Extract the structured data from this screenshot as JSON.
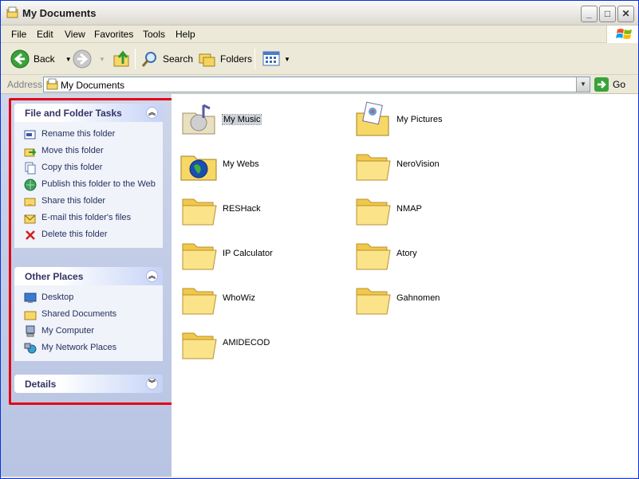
{
  "window": {
    "title": "My Documents"
  },
  "menubar": {
    "items": [
      "File",
      "Edit",
      "View",
      "Favorites",
      "Tools",
      "Help"
    ]
  },
  "toolbar": {
    "back_label": "Back",
    "search_label": "Search",
    "folders_label": "Folders"
  },
  "address": {
    "label": "Address",
    "value": "My Documents",
    "go_label": "Go"
  },
  "taskpane": {
    "file_tasks": {
      "title": "File and Folder Tasks",
      "items": [
        {
          "label": "Rename this folder",
          "icon": "rename-icon"
        },
        {
          "label": "Move this folder",
          "icon": "move-icon"
        },
        {
          "label": "Copy this folder",
          "icon": "copy-icon"
        },
        {
          "label": "Publish this folder to the Web",
          "icon": "publish-web-icon"
        },
        {
          "label": "Share this folder",
          "icon": "share-icon"
        },
        {
          "label": "E-mail this folder's files",
          "icon": "email-icon"
        },
        {
          "label": "Delete this folder",
          "icon": "delete-icon"
        }
      ]
    },
    "other_places": {
      "title": "Other Places",
      "items": [
        {
          "label": "Desktop",
          "icon": "desktop-icon"
        },
        {
          "label": "Shared Documents",
          "icon": "folder-icon"
        },
        {
          "label": "My Computer",
          "icon": "computer-icon"
        },
        {
          "label": "My Network Places",
          "icon": "network-icon"
        }
      ]
    },
    "details": {
      "title": "Details"
    }
  },
  "folders": [
    {
      "name": "My Music",
      "kind": "music",
      "selected": true
    },
    {
      "name": "My Pictures",
      "kind": "pictures"
    },
    {
      "name": "My Webs",
      "kind": "webs"
    },
    {
      "name": "NeroVision",
      "kind": "plain"
    },
    {
      "name": "RESHack",
      "kind": "plain"
    },
    {
      "name": "NMAP",
      "kind": "plain"
    },
    {
      "name": "IP Calculator",
      "kind": "plain"
    },
    {
      "name": "Atory",
      "kind": "plain"
    },
    {
      "name": "WhoWiz",
      "kind": "plain"
    },
    {
      "name": "Gahnomen",
      "kind": "plain"
    },
    {
      "name": "AMIDECOD",
      "kind": "plain"
    }
  ],
  "colors": {
    "highlight_frame": "#e30613",
    "folder_yellow": "#f7d867",
    "taskpane_bg": "#c3cde6"
  }
}
